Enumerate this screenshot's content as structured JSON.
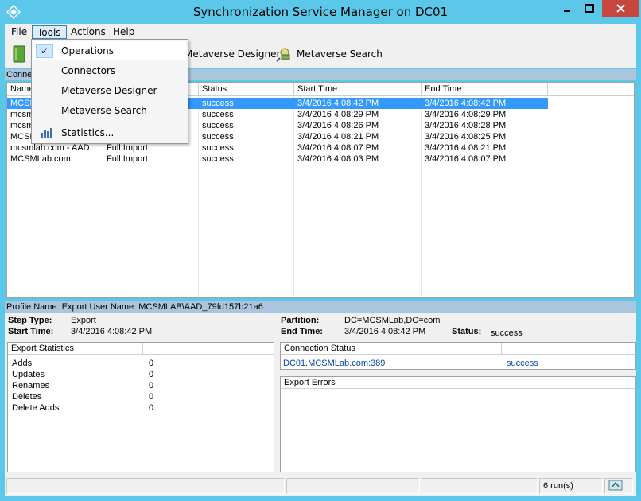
{
  "window": {
    "title": "Synchronization Service Manager on DC01"
  },
  "colors": {
    "titlebar": "#5bc8ea",
    "close": "#c7463e",
    "selection": "#3399ff",
    "section": "#a9c6de"
  },
  "menu": {
    "file": "File",
    "tools": "Tools",
    "actions": "Actions",
    "help": "Help"
  },
  "toolbar": {
    "operations_icon": "operations-book-icon",
    "metaverse_designer_label": "Metaverse Designer",
    "metaverse_search_label": "Metaverse Search"
  },
  "tools_menu": {
    "operations": "Operations",
    "connectors": "Connectors",
    "metaverse_designer": "Metaverse Designer",
    "metaverse_search": "Metaverse Search",
    "statistics": "Statistics..."
  },
  "runs_section": {
    "label": "Conne"
  },
  "runs_table": {
    "columns": [
      "Name",
      "",
      "Status",
      "Start Time",
      "End Time"
    ],
    "rows": [
      {
        "name": "MCSM",
        "profile": "",
        "status": "success",
        "start": "3/4/2016 4:08:42 PM",
        "end": "3/4/2016 4:08:42 PM"
      },
      {
        "name": "mcsm",
        "profile": "",
        "status": "success",
        "start": "3/4/2016 4:08:29 PM",
        "end": "3/4/2016 4:08:29 PM"
      },
      {
        "name": "mcsm",
        "profile": "",
        "status": "success",
        "start": "3/4/2016 4:08:26 PM",
        "end": "3/4/2016 4:08:28 PM"
      },
      {
        "name": "MCSM",
        "profile": "",
        "status": "success",
        "start": "3/4/2016 4:08:21 PM",
        "end": "3/4/2016 4:08:25 PM"
      },
      {
        "name": "mcsmlab.com - AAD",
        "profile": "Full Import",
        "status": "success",
        "start": "3/4/2016 4:08:07 PM",
        "end": "3/4/2016 4:08:21 PM"
      },
      {
        "name": "MCSMLab.com",
        "profile": "Full Import",
        "status": "success",
        "start": "3/4/2016 4:08:03 PM",
        "end": "3/4/2016 4:08:07 PM"
      }
    ]
  },
  "profile_bar": {
    "text": "Profile Name: Export  User Name: MCSMLAB\\AAD_79fd157b21a6"
  },
  "details": {
    "step_type_label": "Step Type:",
    "step_type_value": "Export",
    "start_time_label": "Start Time:",
    "start_time_value": "3/4/2016 4:08:42 PM",
    "partition_label": "Partition:",
    "partition_value": "DC=MCSMLab,DC=com",
    "end_time_label": "End Time:",
    "end_time_value": "3/4/2016 4:08:42 PM",
    "status_label": "Status:",
    "status_value": "success"
  },
  "export_stats": {
    "header": "Export Statistics",
    "rows": [
      {
        "label": "Adds",
        "value": "0"
      },
      {
        "label": "Updates",
        "value": "0"
      },
      {
        "label": "Renames",
        "value": "0"
      },
      {
        "label": "Deletes",
        "value": "0"
      },
      {
        "label": "Delete Adds",
        "value": "0"
      }
    ]
  },
  "connection_status": {
    "header": "Connection Status",
    "server": "DC01.MCSMLab.com:389",
    "result": "success"
  },
  "export_errors": {
    "header": "Export Errors"
  },
  "statusbar": {
    "runs": "6 run(s)"
  }
}
